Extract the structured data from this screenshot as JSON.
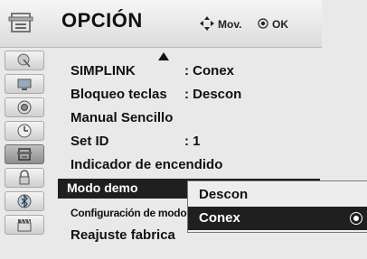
{
  "menu": {
    "title": "OPCIÓN",
    "hint_move": "Mov.",
    "hint_ok": "OK"
  },
  "categories": [
    {
      "icon": "satellite-dish-icon"
    },
    {
      "icon": "tv-picture-icon"
    },
    {
      "icon": "speaker-audio-icon"
    },
    {
      "icon": "clock-time-icon"
    },
    {
      "icon": "option-menu-icon",
      "active": true
    },
    {
      "icon": "lock-icon"
    },
    {
      "icon": "usb-bluetooth-icon"
    },
    {
      "icon": "clapperboard-icon"
    }
  ],
  "items": [
    {
      "label": "SIMPLINK",
      "value": ": Conex"
    },
    {
      "label": "Bloqueo teclas",
      "value": ": Descon"
    },
    {
      "label": "Manual Sencillo",
      "value": ""
    },
    {
      "label": "Set ID",
      "value": ": 1"
    },
    {
      "label": "Indicador de encendido",
      "value": ""
    },
    {
      "label": "Modo demo",
      "value": ""
    },
    {
      "label": "Configuración de modo :",
      "value": ""
    },
    {
      "label": "Reajuste fabrica",
      "value": ""
    }
  ],
  "submenu": {
    "options": [
      "Descon",
      "Conex"
    ],
    "selected": "Conex"
  }
}
